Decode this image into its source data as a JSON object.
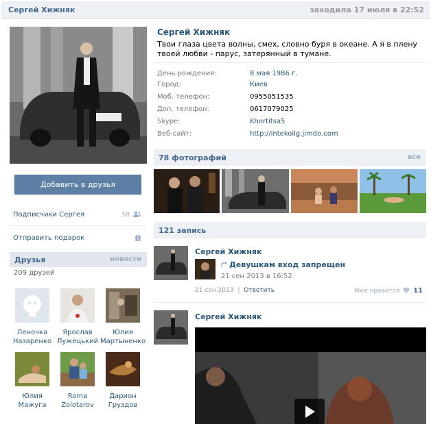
{
  "header": {
    "name": "Сергей Хижняк",
    "status": "заходила 17 июля в 22:52"
  },
  "profile": {
    "name": "Сергей Хижняк",
    "status_text": "Твои глаза цвета волны, смех, словно буря в океане. А я в плену твоей любви - парус, затерянный в тумане.",
    "info": [
      {
        "key": "День рождения:",
        "value": "8 мая 1986 г.",
        "link": true
      },
      {
        "key": "Город:",
        "value": "Киев",
        "link": true
      },
      {
        "key": "Моб. телефон:",
        "value": "0955051535",
        "link": false
      },
      {
        "key": "Доп. телефон:",
        "value": "0617079025",
        "link": false
      },
      {
        "key": "Skype:",
        "value": "Khortitsa5",
        "link": true
      },
      {
        "key": "Веб-сайт:",
        "value": "http://intekoilg.jimdo.com",
        "link": true
      }
    ]
  },
  "sidebar": {
    "add_friend": "Добавить в друзья",
    "subscribers": "Подписчики Сергея",
    "subscribers_count": "58",
    "send_gift": "Отправить подарок",
    "friends_title": "Друзья",
    "friends_news": "новости",
    "friends_count": "209 друзей",
    "friends": [
      {
        "first": "Леночка",
        "last": "Назаренко"
      },
      {
        "first": "Ярослав",
        "last": "Лужецький"
      },
      {
        "first": "Юлия",
        "last": "Мартыненко"
      },
      {
        "first": "Юлия",
        "last": "Мажуга"
      },
      {
        "first": "Roma",
        "last": "Zolotarov"
      },
      {
        "first": "Дарион",
        "last": "Груздов"
      }
    ]
  },
  "photos": {
    "title": "78 фотографий",
    "all": "все"
  },
  "wall": {
    "title": "121 запись",
    "post1": {
      "author": "Сергей Хижняк",
      "repost_title": "Девушкам вход запрещен",
      "repost_date": "21 сен 2013 в 16:52",
      "date": "21 сен 2013",
      "separator": "|",
      "reply": "Ответить",
      "like_label": "Мне нравится",
      "like_count": "11"
    },
    "post2": {
      "author": "Сергей Хижняк"
    }
  },
  "colors": {
    "link": "#2b587a",
    "header_bg": "#edf1f5",
    "button": "#5e80a6"
  }
}
